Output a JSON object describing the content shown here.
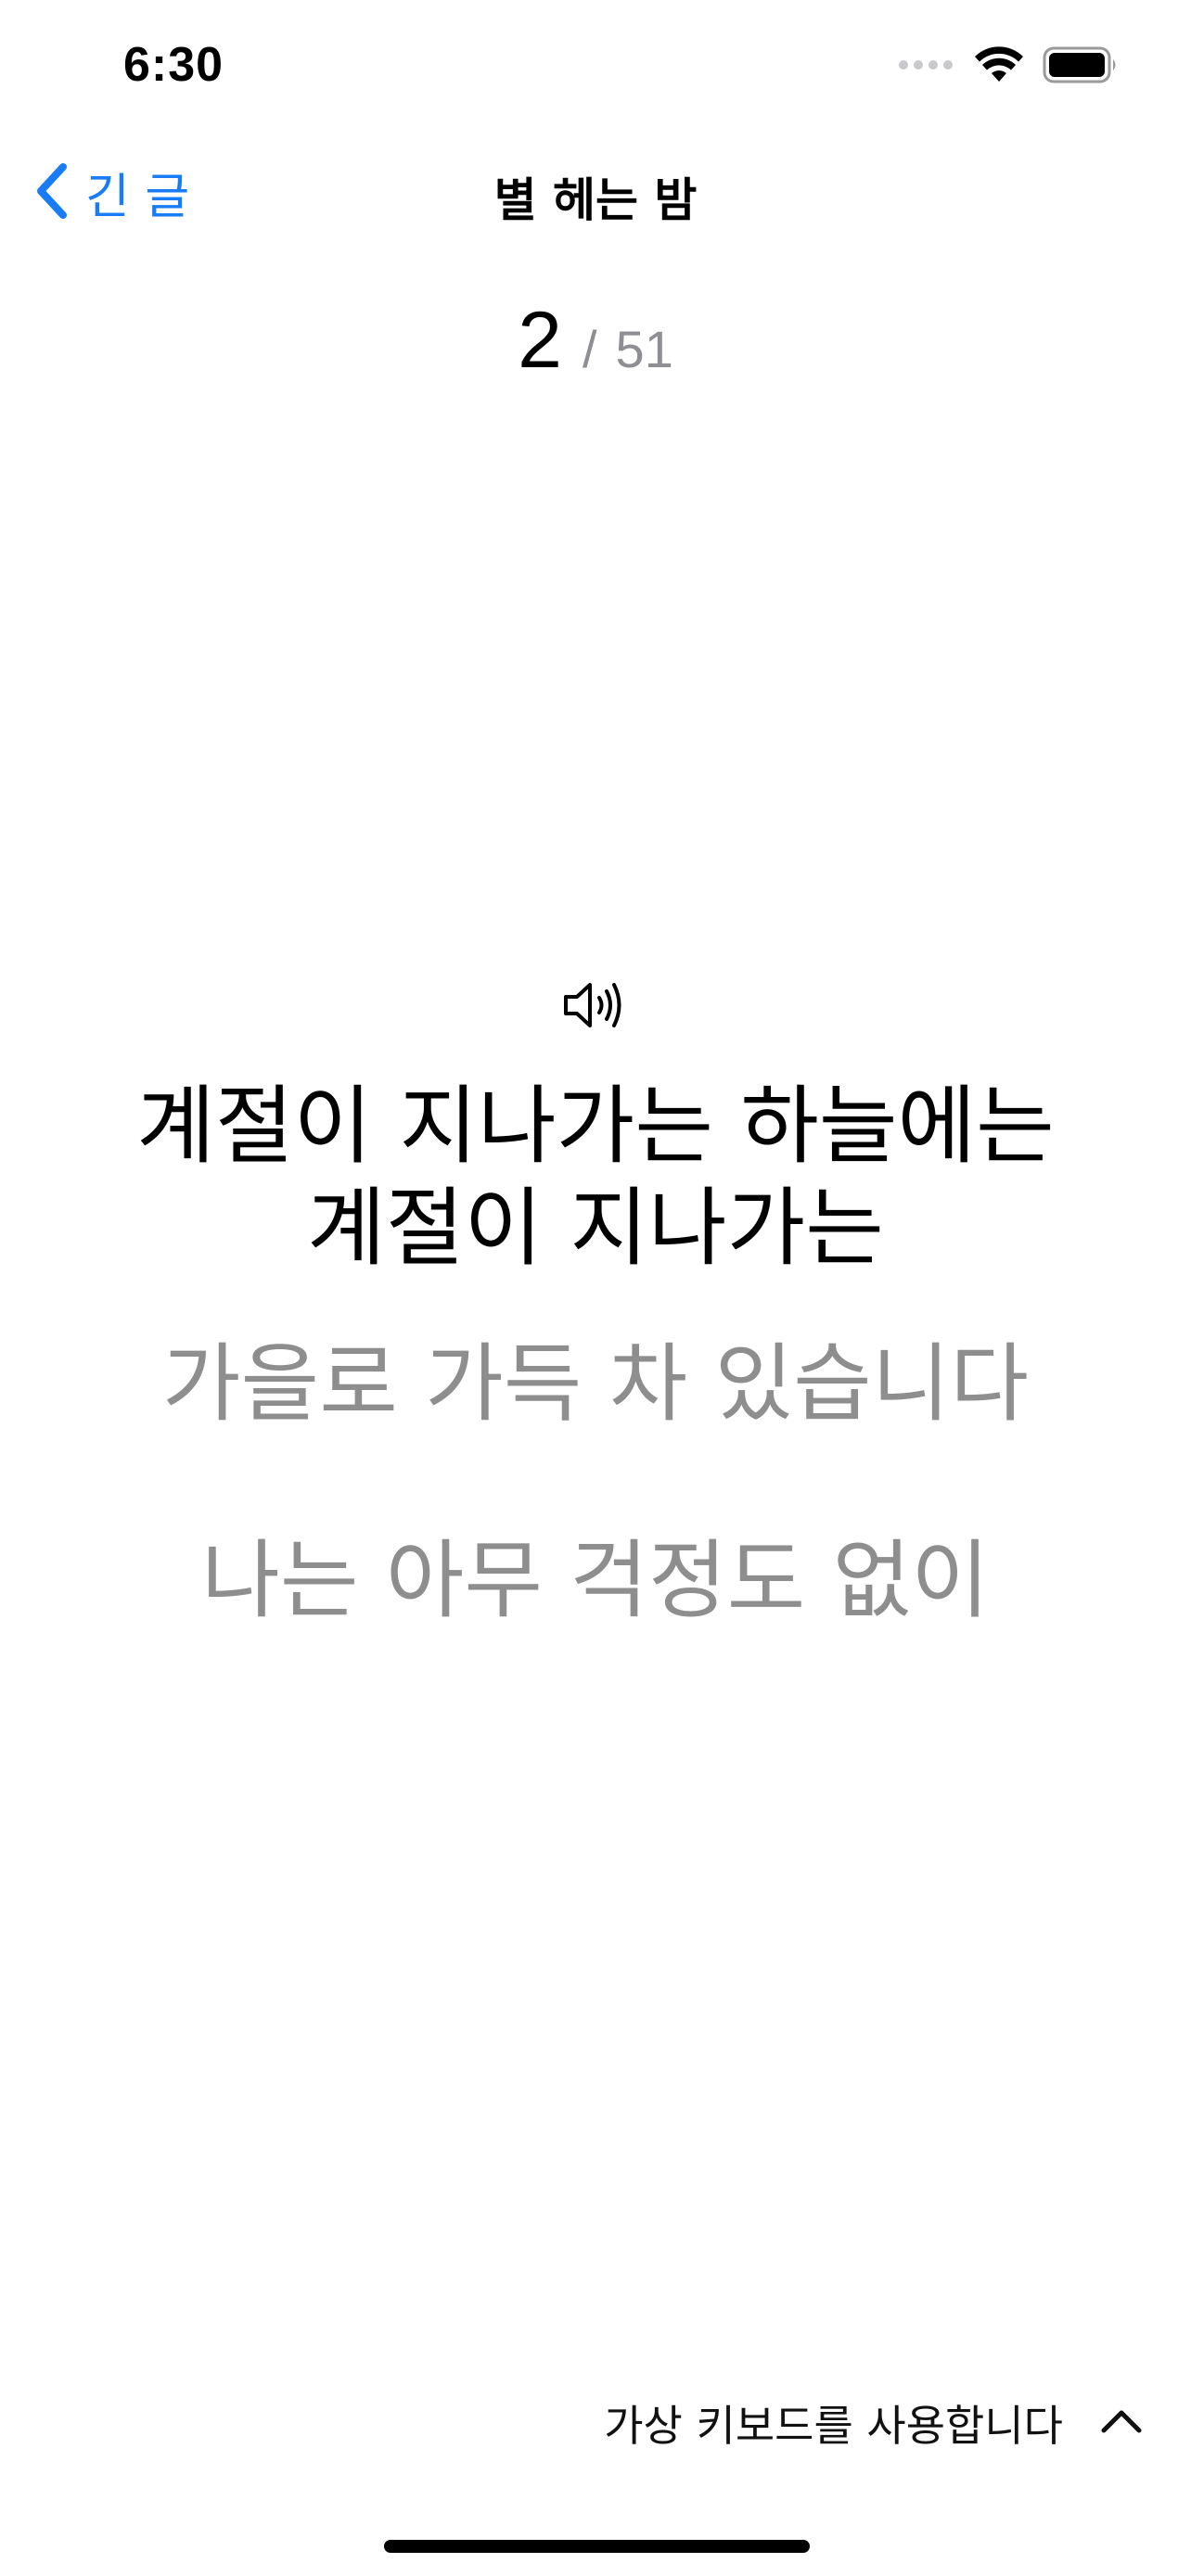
{
  "status_bar": {
    "time": "6:30"
  },
  "nav": {
    "back_label": "긴 글",
    "title": "별 헤는 밤",
    "accent_color": "#1a7cf4"
  },
  "progress": {
    "current": "2",
    "separator": "/",
    "total": "51"
  },
  "content": {
    "current_lines": [
      "계절이 지나가는 하늘에는",
      "계절이 지나가는"
    ],
    "upcoming_lines": [
      "가을로 가득 차 있습니다",
      "나는 아무 걱정도 없이"
    ],
    "upcoming_color": "#8e8e8e"
  },
  "footer": {
    "keyboard_label": "가상 키보드를 사용합니다"
  },
  "icons": {
    "back": "chevron-left-icon",
    "speaker": "speaker-icon",
    "expand": "chevron-up-icon",
    "signal": "signal-icon",
    "wifi": "wifi-icon",
    "battery": "battery-icon"
  }
}
